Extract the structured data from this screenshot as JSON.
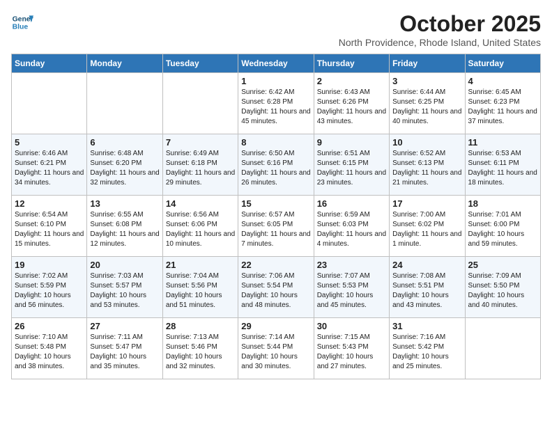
{
  "header": {
    "logo_general": "General",
    "logo_blue": "Blue",
    "month": "October 2025",
    "location": "North Providence, Rhode Island, United States"
  },
  "columns": [
    "Sunday",
    "Monday",
    "Tuesday",
    "Wednesday",
    "Thursday",
    "Friday",
    "Saturday"
  ],
  "weeks": [
    [
      {
        "day": "",
        "info": ""
      },
      {
        "day": "",
        "info": ""
      },
      {
        "day": "",
        "info": ""
      },
      {
        "day": "1",
        "info": "Sunrise: 6:42 AM\nSunset: 6:28 PM\nDaylight: 11 hours\nand 45 minutes."
      },
      {
        "day": "2",
        "info": "Sunrise: 6:43 AM\nSunset: 6:26 PM\nDaylight: 11 hours\nand 43 minutes."
      },
      {
        "day": "3",
        "info": "Sunrise: 6:44 AM\nSunset: 6:25 PM\nDaylight: 11 hours\nand 40 minutes."
      },
      {
        "day": "4",
        "info": "Sunrise: 6:45 AM\nSunset: 6:23 PM\nDaylight: 11 hours\nand 37 minutes."
      }
    ],
    [
      {
        "day": "5",
        "info": "Sunrise: 6:46 AM\nSunset: 6:21 PM\nDaylight: 11 hours\nand 34 minutes."
      },
      {
        "day": "6",
        "info": "Sunrise: 6:48 AM\nSunset: 6:20 PM\nDaylight: 11 hours\nand 32 minutes."
      },
      {
        "day": "7",
        "info": "Sunrise: 6:49 AM\nSunset: 6:18 PM\nDaylight: 11 hours\nand 29 minutes."
      },
      {
        "day": "8",
        "info": "Sunrise: 6:50 AM\nSunset: 6:16 PM\nDaylight: 11 hours\nand 26 minutes."
      },
      {
        "day": "9",
        "info": "Sunrise: 6:51 AM\nSunset: 6:15 PM\nDaylight: 11 hours\nand 23 minutes."
      },
      {
        "day": "10",
        "info": "Sunrise: 6:52 AM\nSunset: 6:13 PM\nDaylight: 11 hours\nand 21 minutes."
      },
      {
        "day": "11",
        "info": "Sunrise: 6:53 AM\nSunset: 6:11 PM\nDaylight: 11 hours\nand 18 minutes."
      }
    ],
    [
      {
        "day": "12",
        "info": "Sunrise: 6:54 AM\nSunset: 6:10 PM\nDaylight: 11 hours\nand 15 minutes."
      },
      {
        "day": "13",
        "info": "Sunrise: 6:55 AM\nSunset: 6:08 PM\nDaylight: 11 hours\nand 12 minutes."
      },
      {
        "day": "14",
        "info": "Sunrise: 6:56 AM\nSunset: 6:06 PM\nDaylight: 11 hours\nand 10 minutes."
      },
      {
        "day": "15",
        "info": "Sunrise: 6:57 AM\nSunset: 6:05 PM\nDaylight: 11 hours\nand 7 minutes."
      },
      {
        "day": "16",
        "info": "Sunrise: 6:59 AM\nSunset: 6:03 PM\nDaylight: 11 hours\nand 4 minutes."
      },
      {
        "day": "17",
        "info": "Sunrise: 7:00 AM\nSunset: 6:02 PM\nDaylight: 11 hours\nand 1 minute."
      },
      {
        "day": "18",
        "info": "Sunrise: 7:01 AM\nSunset: 6:00 PM\nDaylight: 10 hours\nand 59 minutes."
      }
    ],
    [
      {
        "day": "19",
        "info": "Sunrise: 7:02 AM\nSunset: 5:59 PM\nDaylight: 10 hours\nand 56 minutes."
      },
      {
        "day": "20",
        "info": "Sunrise: 7:03 AM\nSunset: 5:57 PM\nDaylight: 10 hours\nand 53 minutes."
      },
      {
        "day": "21",
        "info": "Sunrise: 7:04 AM\nSunset: 5:56 PM\nDaylight: 10 hours\nand 51 minutes."
      },
      {
        "day": "22",
        "info": "Sunrise: 7:06 AM\nSunset: 5:54 PM\nDaylight: 10 hours\nand 48 minutes."
      },
      {
        "day": "23",
        "info": "Sunrise: 7:07 AM\nSunset: 5:53 PM\nDaylight: 10 hours\nand 45 minutes."
      },
      {
        "day": "24",
        "info": "Sunrise: 7:08 AM\nSunset: 5:51 PM\nDaylight: 10 hours\nand 43 minutes."
      },
      {
        "day": "25",
        "info": "Sunrise: 7:09 AM\nSunset: 5:50 PM\nDaylight: 10 hours\nand 40 minutes."
      }
    ],
    [
      {
        "day": "26",
        "info": "Sunrise: 7:10 AM\nSunset: 5:48 PM\nDaylight: 10 hours\nand 38 minutes."
      },
      {
        "day": "27",
        "info": "Sunrise: 7:11 AM\nSunset: 5:47 PM\nDaylight: 10 hours\nand 35 minutes."
      },
      {
        "day": "28",
        "info": "Sunrise: 7:13 AM\nSunset: 5:46 PM\nDaylight: 10 hours\nand 32 minutes."
      },
      {
        "day": "29",
        "info": "Sunrise: 7:14 AM\nSunset: 5:44 PM\nDaylight: 10 hours\nand 30 minutes."
      },
      {
        "day": "30",
        "info": "Sunrise: 7:15 AM\nSunset: 5:43 PM\nDaylight: 10 hours\nand 27 minutes."
      },
      {
        "day": "31",
        "info": "Sunrise: 7:16 AM\nSunset: 5:42 PM\nDaylight: 10 hours\nand 25 minutes."
      },
      {
        "day": "",
        "info": ""
      }
    ]
  ]
}
